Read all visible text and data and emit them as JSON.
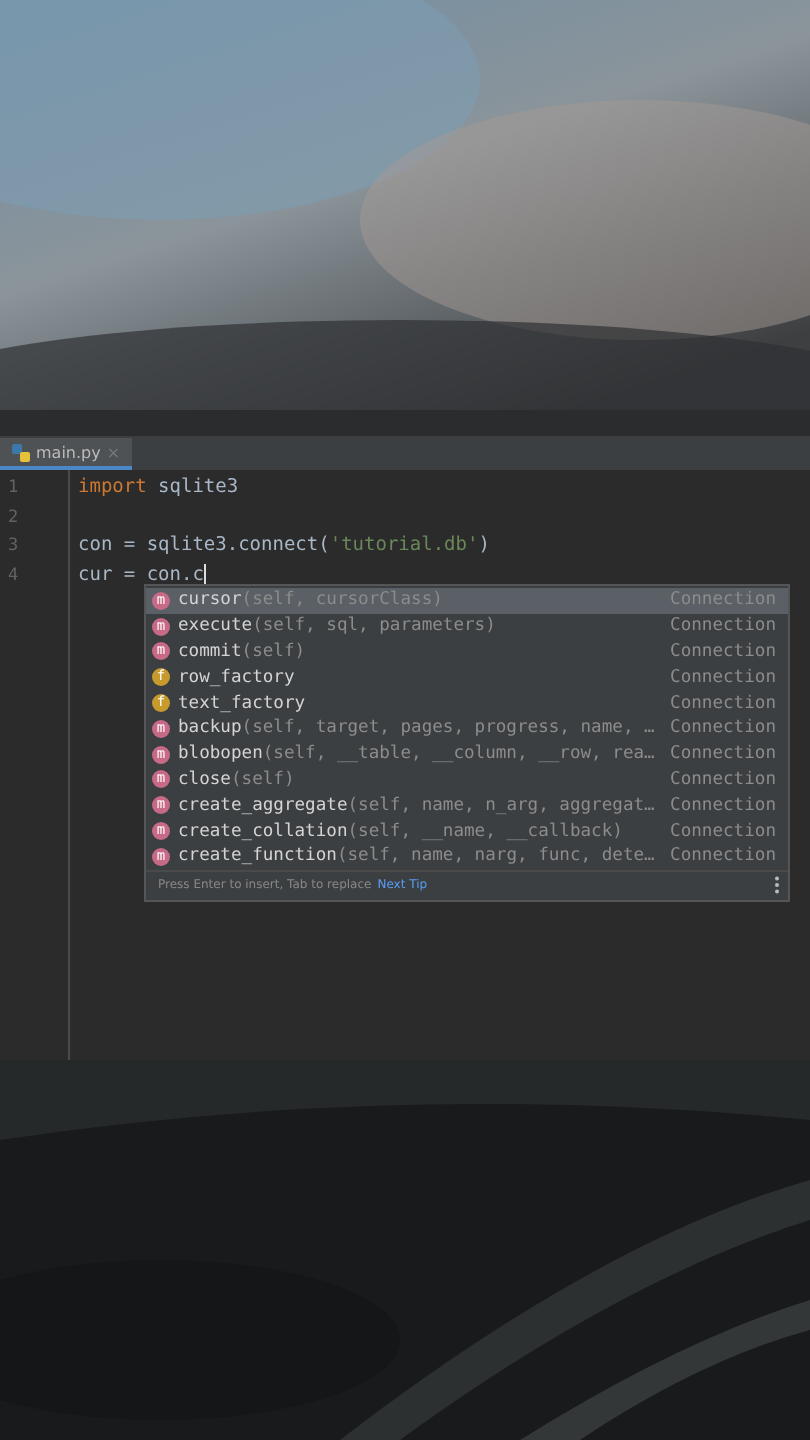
{
  "tab": {
    "label": "main.py",
    "selected": true,
    "close": "×"
  },
  "code_lines": [
    {
      "number": "1",
      "segments": [
        {
          "kind": "keyword",
          "text": "import"
        },
        {
          "kind": "plain",
          "text": " sqlite3"
        }
      ]
    },
    {
      "number": "2"
    },
    {
      "number": "3",
      "segments": [
        {
          "kind": "plain",
          "text": "con = sqlite3.connect("
        },
        {
          "kind": "string",
          "text": "'tutorial.db'"
        },
        {
          "kind": "plain",
          "text": ")"
        }
      ]
    },
    {
      "number": "4",
      "segments": [
        {
          "kind": "plain",
          "text": "cur = con.c"
        }
      ],
      "caret": true
    }
  ],
  "completion": {
    "items": [
      {
        "kind": "method",
        "badge": "m",
        "name": "cursor",
        "params": "(self, cursorClass)",
        "type": "Connection",
        "selected": true
      },
      {
        "kind": "method",
        "badge": "m",
        "name": "execute",
        "params": "(self, sql, parameters)",
        "type": "Connection",
        "selected": false
      },
      {
        "kind": "method",
        "badge": "m",
        "name": "commit",
        "params": "(self)",
        "type": "Connection",
        "selected": false
      },
      {
        "kind": "field",
        "badge": "f",
        "name": "row_factory",
        "type": "Connection",
        "selected": false
      },
      {
        "kind": "field",
        "badge": "f",
        "name": "text_factory",
        "type": "Connection",
        "selected": false
      },
      {
        "kind": "method",
        "badge": "m",
        "name": "backup",
        "params": "(self, target, pages, progress, name, …",
        "type": "Connection",
        "selected": false
      },
      {
        "kind": "method",
        "badge": "m",
        "name": "blobopen",
        "params": "(self, __table, __column, __row, rea…",
        "type": "Connection",
        "selected": false
      },
      {
        "kind": "method",
        "badge": "m",
        "name": "close",
        "params": "(self)",
        "type": "Connection",
        "selected": false
      },
      {
        "kind": "method",
        "badge": "m",
        "name": "create_aggregate",
        "params": "(self, name, n_arg, aggregat…",
        "type": "Connection",
        "selected": false
      },
      {
        "kind": "method",
        "badge": "m",
        "name": "create_collation",
        "params": "(self, __name, __callback)",
        "type": "Connection",
        "selected": false
      },
      {
        "kind": "method",
        "badge": "m",
        "name": "create_function",
        "params": "(self, name, narg, func, dete…",
        "type": "Connection",
        "selected": false
      }
    ],
    "hint": "Press Enter to insert, Tab to replace",
    "tip_link": "Next Tip"
  }
}
